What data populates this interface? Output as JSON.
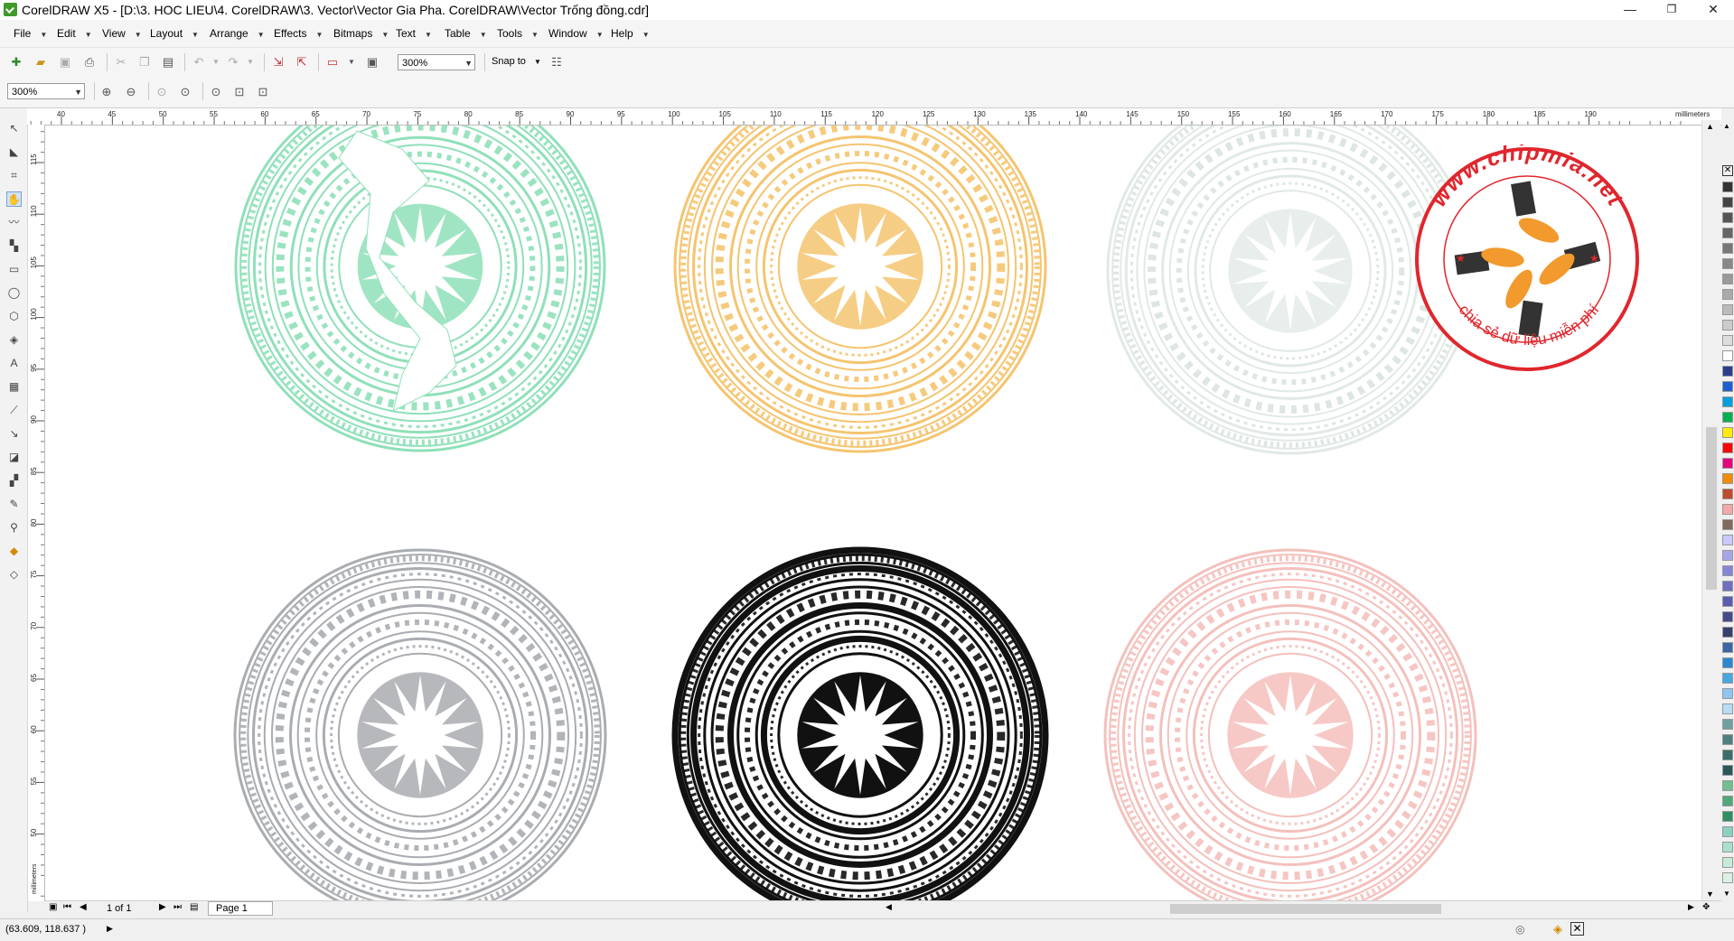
{
  "window": {
    "title": "CorelDRAW X5 - [D:\\3. HOC LIEU\\4. CorelDRAW\\3. Vector\\Vector Gia Pha. CorelDRAW\\Vector Trống đồng.cdr]",
    "minimize": "—",
    "restore": "❐",
    "close": "✕"
  },
  "menu": [
    "File",
    "Edit",
    "View",
    "Layout",
    "Arrange",
    "Effects",
    "Bitmaps",
    "Text",
    "Table",
    "Tools",
    "Window",
    "Help"
  ],
  "toolbar": {
    "zoom_level": "300%",
    "snap_to": "Snap to"
  },
  "zoombar": {
    "zoom_level": "300%"
  },
  "ruler": {
    "unit": "millimeters",
    "top_ticks": [
      "40",
      "45",
      "50",
      "55",
      "60",
      "65",
      "70",
      "75",
      "80",
      "85",
      "90",
      "95",
      "100",
      "105",
      "110",
      "115",
      "120",
      "125",
      "130",
      "135",
      "140",
      "145",
      "150",
      "155",
      "160",
      "165",
      "170",
      "175",
      "180",
      "185",
      "190"
    ],
    "left_ticks": [
      "115",
      "110",
      "105",
      "100",
      "95",
      "90",
      "85",
      "80",
      "75",
      "70",
      "65",
      "60",
      "55",
      "50"
    ],
    "left_unit": "millimeters"
  },
  "drawing": {
    "medallions": [
      {
        "name": "drum-green-vietnam-map",
        "color": "#8fe0b8"
      },
      {
        "name": "drum-orange",
        "color": "#f5c46f"
      },
      {
        "name": "drum-light-gray",
        "color": "#d9e3df"
      },
      {
        "name": "drum-gray",
        "color": "#a9acb0"
      },
      {
        "name": "drum-black",
        "color": "#111111"
      },
      {
        "name": "drum-pink",
        "color": "#f4c0bc"
      }
    ]
  },
  "watermark": {
    "url_text": "www.chipmia.net",
    "tagline": "chia sẻ dữ liệu miễn phí",
    "ring_color": "#e0262d"
  },
  "pagebar": {
    "page_count": "1 of 1",
    "page_tab": "Page 1"
  },
  "status": {
    "coordinates": "(63.609, 118.637 )"
  },
  "palette": [
    "#333333",
    "#444444",
    "#555555",
    "#666666",
    "#777777",
    "#888888",
    "#999999",
    "#aaaaaa",
    "#bbbbbb",
    "#cccccc",
    "#dddddd",
    "#ffffff",
    "#2b3d8f",
    "#1c5fd1",
    "#00a0e0",
    "#00b050",
    "#ffeb00",
    "#ff0000",
    "#e6007e",
    "#f08c00",
    "#c04a2c",
    "#f7a8a8",
    "#7f6a5c",
    "#c9c9ff",
    "#a6a6e8",
    "#8585d6",
    "#6f6fc2",
    "#5a5aae",
    "#454a8a",
    "#35406e",
    "#3a66a6",
    "#2b87d1",
    "#47a7e0",
    "#8dc6f0",
    "#b7dcf5",
    "#6fa0a0",
    "#4e8080",
    "#3b6b6b",
    "#2a5757",
    "#6fbf8f",
    "#4fa87a",
    "#2f8f62",
    "#8ad1c1",
    "#a9e0d0",
    "#c6ecd8",
    "#d9f2e3"
  ]
}
